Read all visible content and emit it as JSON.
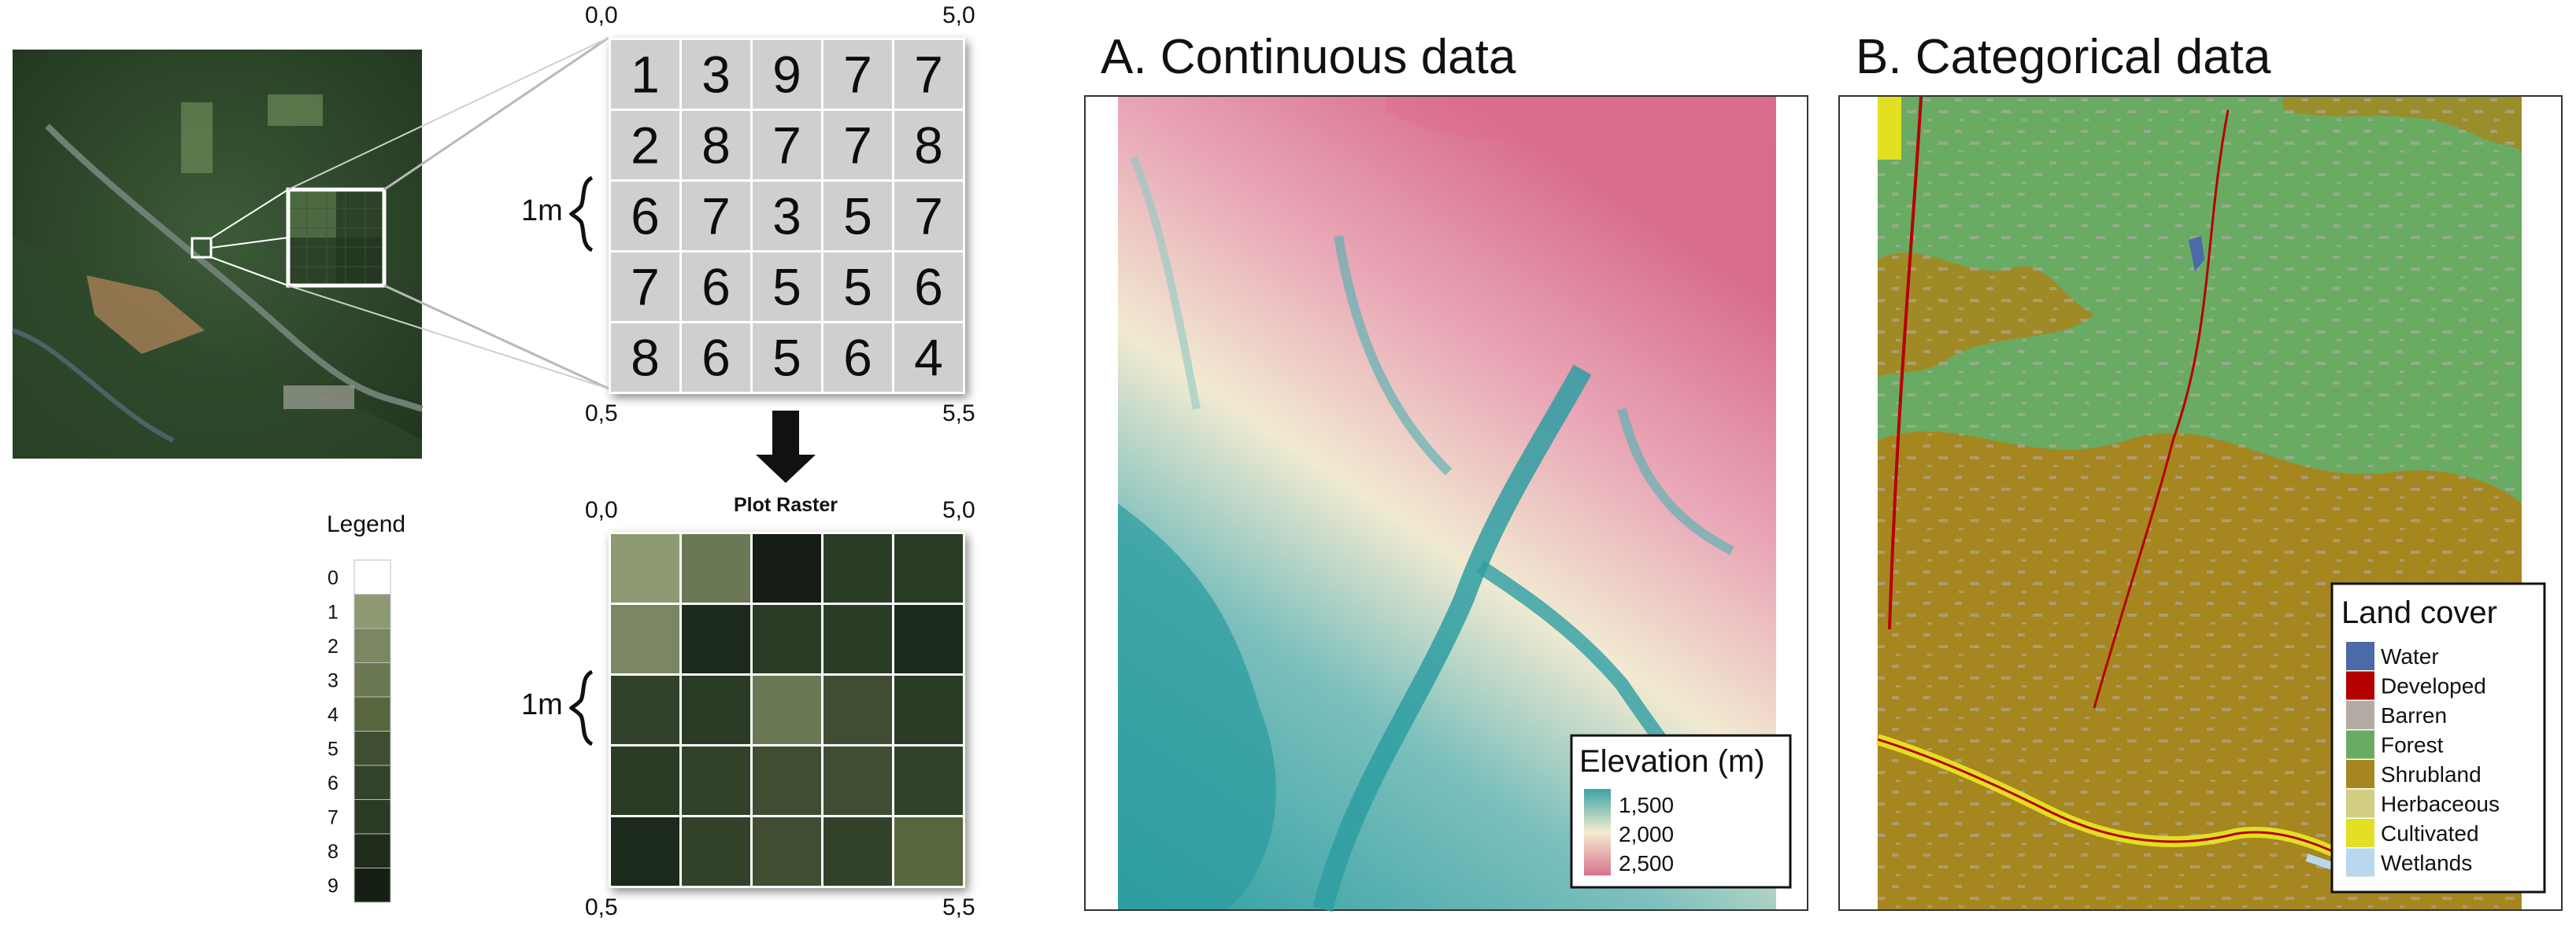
{
  "raster_demo": {
    "top_grid": {
      "corner_labels": {
        "top_left": "0,0",
        "top_right": "5,0",
        "bottom_left": "0,5",
        "bottom_right": "5,5"
      },
      "values": [
        [
          1,
          3,
          9,
          7,
          7
        ],
        [
          2,
          8,
          7,
          7,
          8
        ],
        [
          6,
          7,
          3,
          5,
          7
        ],
        [
          7,
          6,
          5,
          5,
          6
        ],
        [
          8,
          6,
          5,
          6,
          4
        ]
      ]
    },
    "scale_label": "1m",
    "arrow_label": "Plot Raster",
    "bottom_grid": {
      "corner_labels": {
        "top_left": "0,0",
        "top_right": "5,0",
        "bottom_left": "0,5",
        "bottom_right": "5,5"
      }
    },
    "legend": {
      "title": "Legend",
      "items": [
        {
          "value": "0",
          "color": "#ffffff"
        },
        {
          "value": "1",
          "color": "#8d9a73"
        },
        {
          "value": "2",
          "color": "#7a8762"
        },
        {
          "value": "3",
          "color": "#6b7854"
        },
        {
          "value": "4",
          "color": "#58663f"
        },
        {
          "value": "5",
          "color": "#3f4e33"
        },
        {
          "value": "6",
          "color": "#33422a"
        },
        {
          "value": "7",
          "color": "#2a3a25"
        },
        {
          "value": "8",
          "color": "#1f2c1b"
        },
        {
          "value": "9",
          "color": "#161f13"
        }
      ]
    }
  },
  "panel_a": {
    "title": "A. Continuous data",
    "legend": {
      "title": "Elevation (m)",
      "items": [
        {
          "label": "1,500",
          "color": "#3aa3a5"
        },
        {
          "label": "2,000",
          "color": "#f4ecd0"
        },
        {
          "label": "2,500",
          "color": "#d8738f"
        }
      ]
    }
  },
  "panel_b": {
    "title": "B. Categorical data",
    "legend": {
      "title": "Land cover",
      "items": [
        {
          "label": "Water",
          "color": "#4a6aa8"
        },
        {
          "label": "Developed",
          "color": "#b50000"
        },
        {
          "label": "Barren",
          "color": "#b3aba6"
        },
        {
          "label": "Forest",
          "color": "#69ab62"
        },
        {
          "label": "Shrubland",
          "color": "#a6861f"
        },
        {
          "label": "Herbaceous",
          "color": "#d2ce84"
        },
        {
          "label": "Cultivated",
          "color": "#e3df22"
        },
        {
          "label": "Wetlands",
          "color": "#b9d8ee"
        }
      ]
    }
  }
}
